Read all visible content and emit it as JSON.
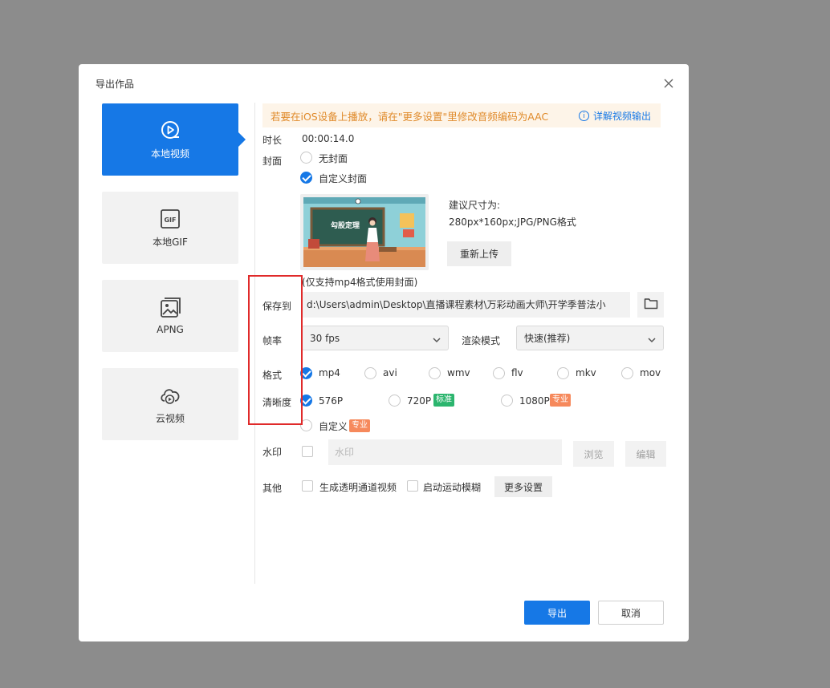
{
  "dialog": {
    "title": "导出作品"
  },
  "sidebar": {
    "items": [
      {
        "label": "本地视频",
        "icon": "play-circle-icon",
        "active": true
      },
      {
        "label": "本地GIF",
        "icon": "gif-icon",
        "active": false
      },
      {
        "label": "APNG",
        "icon": "image-icon",
        "active": false
      },
      {
        "label": "云视频",
        "icon": "cloud-play-icon",
        "active": false
      }
    ]
  },
  "notice": {
    "message": "若要在iOS设备上播放，请在\"更多设置\"里修改音频编码为AAC",
    "link": "详解视频输出"
  },
  "duration": {
    "label": "时长",
    "value": "00:00:14.0"
  },
  "cover": {
    "label": "封面",
    "option_none": "无封面",
    "option_custom": "自定义封面",
    "custom_selected": true,
    "image_text": "勾股定理",
    "hint_title": "建议尺寸为:",
    "hint_size": "280px*160px;JPG/PNG格式",
    "reupload": "重新上传",
    "note": "(仅支持mp4格式使用封面)"
  },
  "save": {
    "label": "保存到",
    "path": "d:\\Users\\admin\\Desktop\\直播课程素材\\万彩动画大师\\开学季普法小"
  },
  "framerate": {
    "label": "帧率",
    "value": "30 fps"
  },
  "render": {
    "label": "渲染模式",
    "value": "快速(推荐)"
  },
  "format": {
    "label": "格式",
    "options": [
      "mp4",
      "avi",
      "wmv",
      "flv",
      "mkv",
      "mov"
    ],
    "selected": "mp4"
  },
  "resolution": {
    "label": "清晰度",
    "options": [
      {
        "label": "576P",
        "badge": ""
      },
      {
        "label": "720P",
        "badge": "标准"
      },
      {
        "label": "1080P",
        "badge": "专业"
      },
      {
        "label": "自定义",
        "badge": "专业"
      }
    ],
    "selected": "576P"
  },
  "watermark": {
    "label": "水印",
    "placeholder": "水印",
    "browse": "浏览",
    "edit": "编辑"
  },
  "other": {
    "label": "其他",
    "transparent": "生成透明通道视频",
    "motion_blur": "启动运动模糊",
    "more": "更多设置"
  },
  "footer": {
    "export": "导出",
    "cancel": "取消"
  },
  "colors": {
    "accent": "#1678e6",
    "notice_text": "#e08a2a",
    "highlight_box": "#e02a2a",
    "badge_green": "#2cb56e",
    "badge_orange": "#f6895c"
  }
}
